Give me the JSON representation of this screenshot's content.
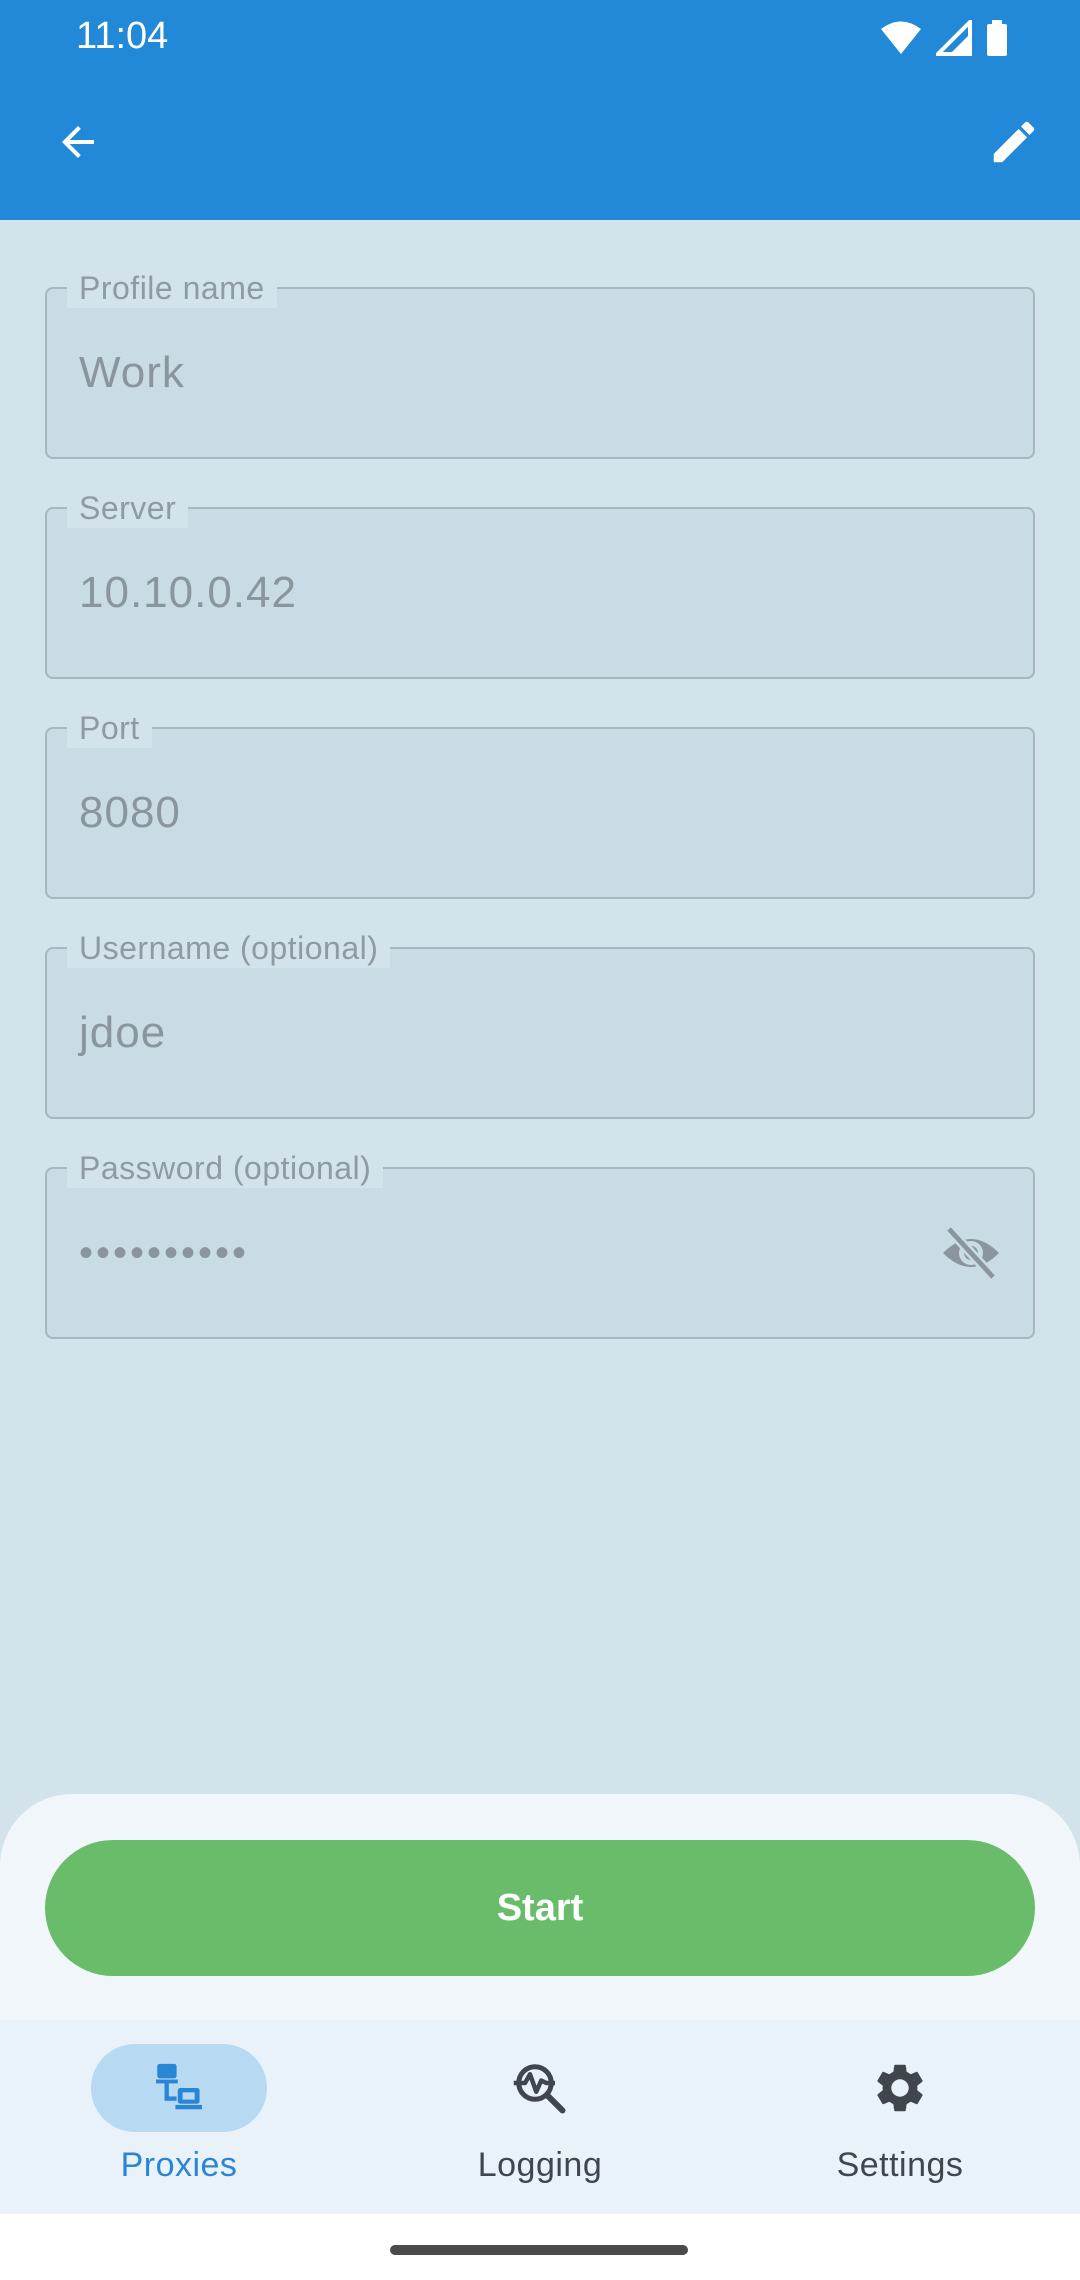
{
  "status_bar": {
    "time": "11:04"
  },
  "toolbar": {
    "back_icon": "arrow-left-icon",
    "edit_icon": "pencil-icon"
  },
  "form": {
    "fields": [
      {
        "label": "Profile name",
        "value": "Work"
      },
      {
        "label": "Server",
        "value": "10.10.0.42"
      },
      {
        "label": "Port",
        "value": "8080"
      },
      {
        "label": "Username (optional)",
        "value": "jdoe"
      },
      {
        "label": "Password (optional)",
        "value": "••••••••••",
        "toggle_icon": "eye-off-icon"
      }
    ]
  },
  "actions": {
    "start_label": "Start"
  },
  "bottom_nav": {
    "items": [
      {
        "label": "Proxies",
        "icon": "network-devices-icon",
        "active": true
      },
      {
        "label": "Logging",
        "icon": "search-activity-icon",
        "active": false
      },
      {
        "label": "Settings",
        "icon": "gear-icon",
        "active": false
      }
    ]
  },
  "colors": {
    "app_bar": "#2288d8",
    "background": "#d3e3ec",
    "start_button": "#69bd6a",
    "active_nav": "#2a86d4"
  }
}
